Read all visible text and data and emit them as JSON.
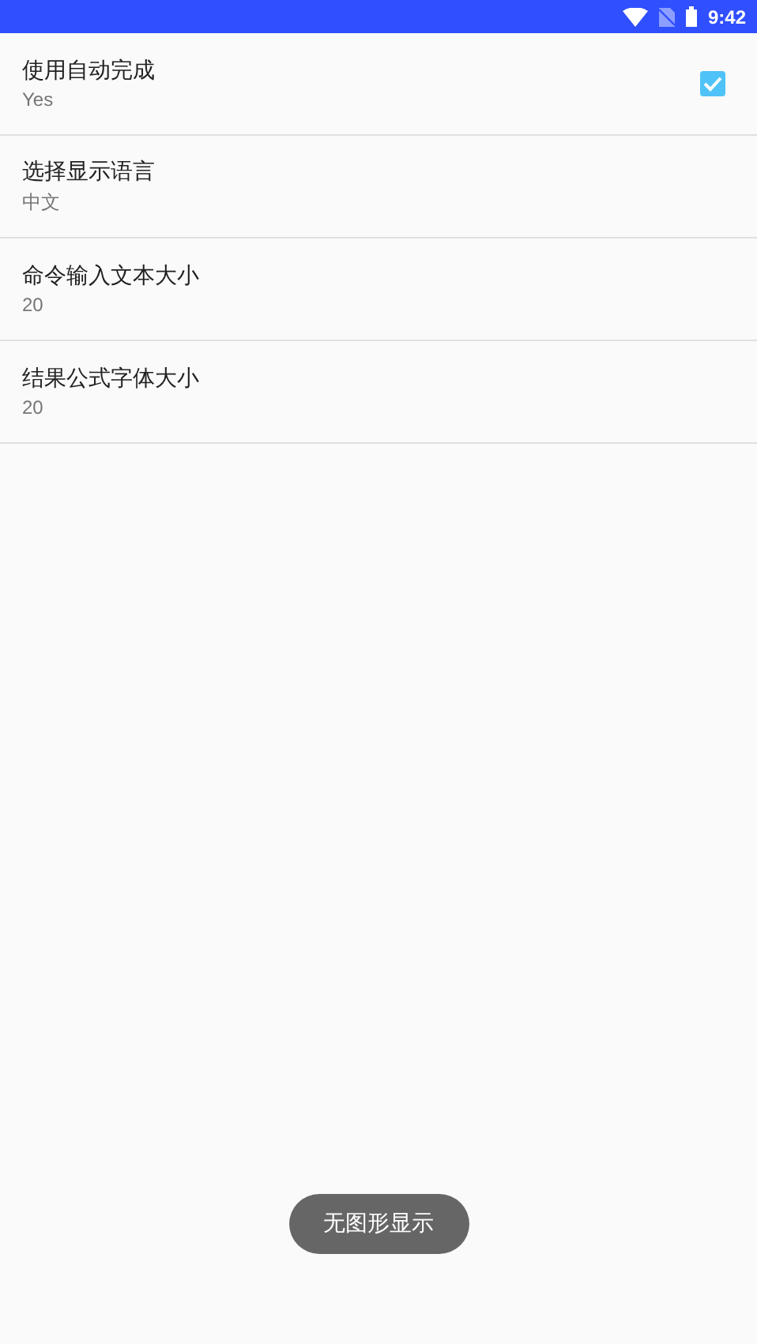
{
  "status_bar": {
    "time": "9:42"
  },
  "settings": [
    {
      "kind": "checkbox",
      "title": "使用自动完成",
      "summary": "Yes",
      "checked": true
    },
    {
      "kind": "text",
      "title": "选择显示语言",
      "summary": "中文"
    },
    {
      "kind": "text",
      "title": "命令输入文本大小",
      "summary": "20"
    },
    {
      "kind": "text",
      "title": "结果公式字体大小",
      "summary": "20"
    }
  ],
  "toast": {
    "text": "无图形显示"
  }
}
